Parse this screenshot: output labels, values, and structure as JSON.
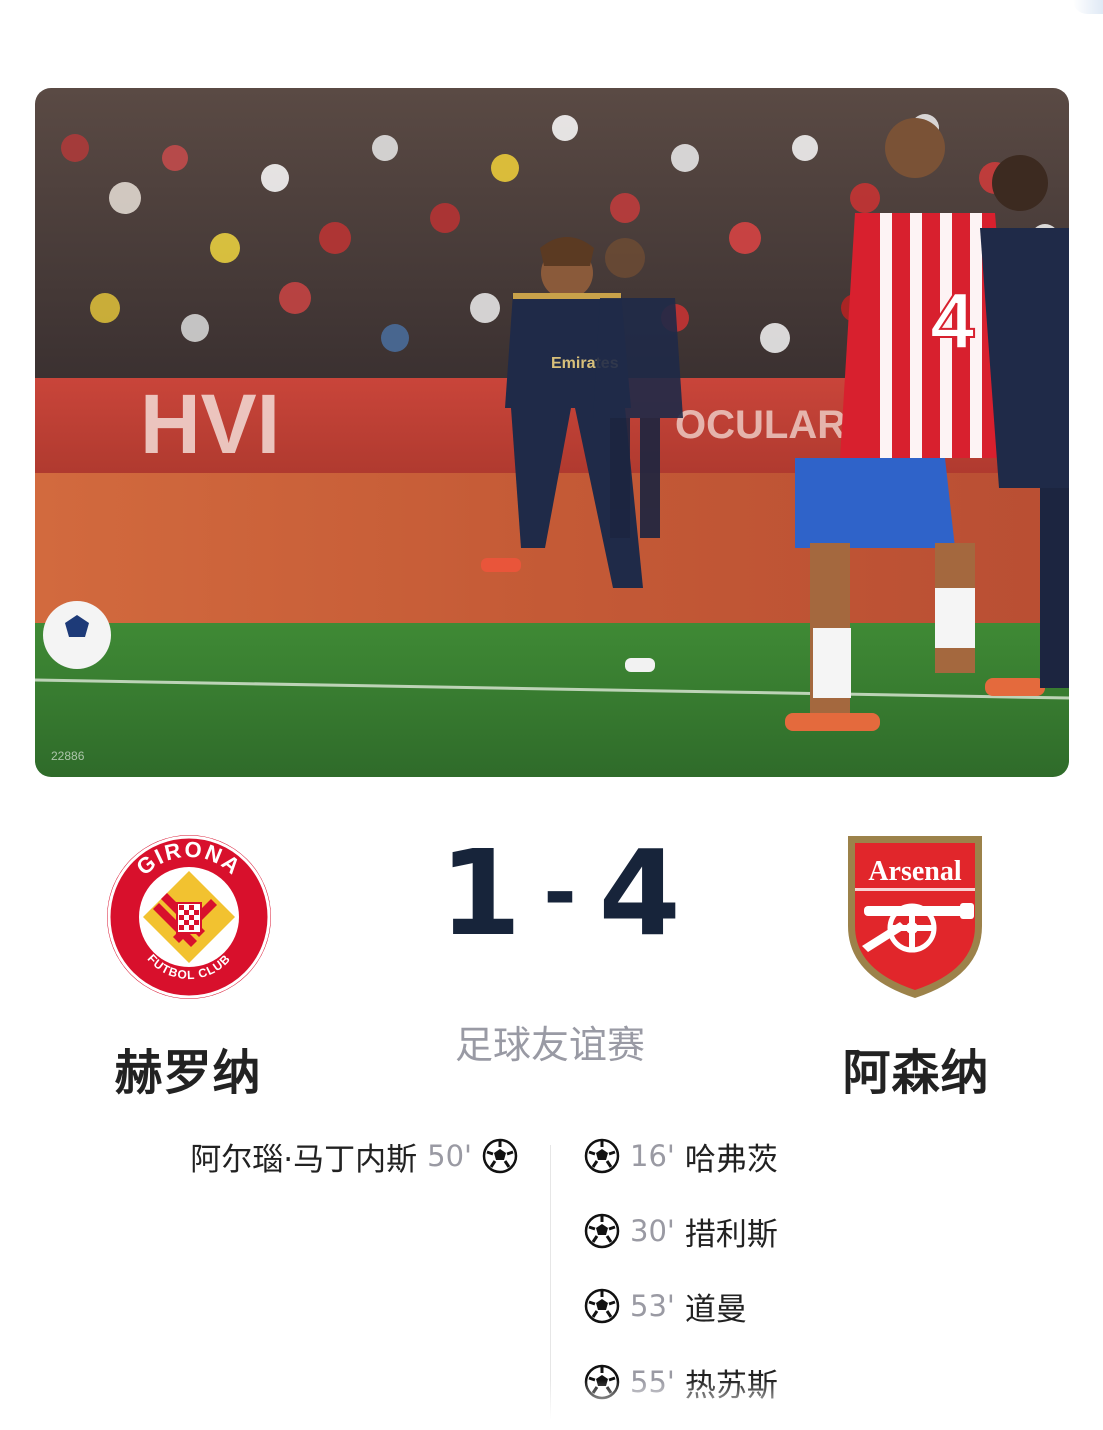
{
  "hero": {
    "watermark_id": "22886"
  },
  "match": {
    "home_team": "赫罗纳",
    "away_team": "阿森纳",
    "home_score": "1",
    "separator": "-",
    "away_score": "4",
    "competition": "足球友谊赛"
  },
  "crests": {
    "home_ring_top": "GIRONA",
    "home_ring_bottom": "FUTBOL CLUB",
    "away_wordmark": "Arsenal"
  },
  "goals": {
    "home": [
      {
        "player": "阿尔瑙·马丁内斯",
        "minute": "50'"
      }
    ],
    "away": [
      {
        "player": "哈弗茨",
        "minute": "16'"
      },
      {
        "player": "措利斯",
        "minute": "30'"
      },
      {
        "player": "道曼",
        "minute": "53'"
      },
      {
        "player": "热苏斯",
        "minute": "55'"
      }
    ]
  },
  "icons": {
    "goal": "soccer-ball-icon"
  },
  "colors": {
    "score": "#17243a",
    "muted": "#9a9aa3",
    "girona_red": "#d8102c",
    "arsenal_red": "#e1262b",
    "arsenal_gold": "#9c824a"
  }
}
